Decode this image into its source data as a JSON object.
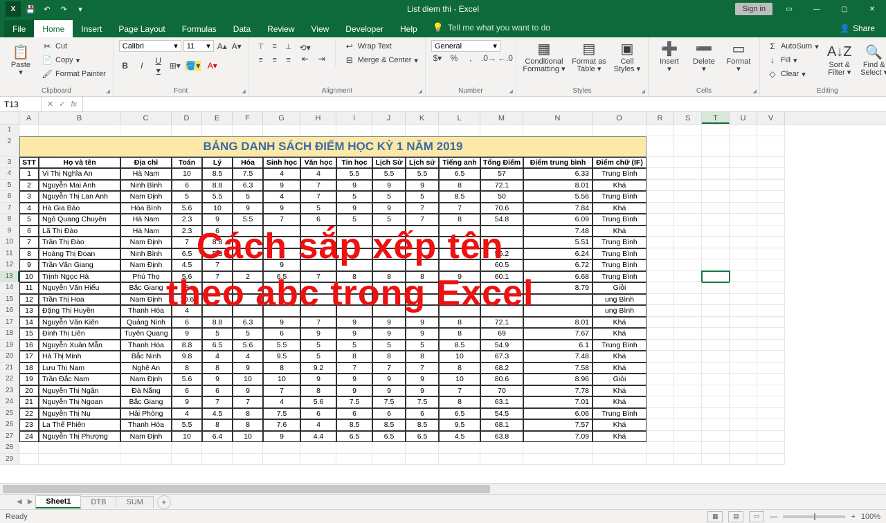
{
  "app": {
    "title": "List diem thi  -  Excel",
    "signin": "Sign in"
  },
  "tabs": {
    "file": "File",
    "home": "Home",
    "insert": "Insert",
    "page_layout": "Page Layout",
    "formulas": "Formulas",
    "data": "Data",
    "review": "Review",
    "view": "View",
    "developer": "Developer",
    "help": "Help",
    "tell_me": "Tell me what you want to do",
    "share": "Share"
  },
  "ribbon": {
    "paste": "Paste",
    "cut": "Cut",
    "copy": "Copy",
    "format_painter": "Format Painter",
    "clipboard": "Clipboard",
    "font_name": "Calibri",
    "font_size": "11",
    "font": "Font",
    "wrap": "Wrap Text",
    "merge": "Merge & Center",
    "alignment": "Alignment",
    "num_format": "General",
    "number": "Number",
    "cond": "Conditional Formatting",
    "fat": "Format as Table",
    "cellsty": "Cell Styles",
    "styles": "Styles",
    "insert": "Insert",
    "delete": "Delete",
    "format": "Format",
    "cells": "Cells",
    "autosum": "AutoSum",
    "fill": "Fill",
    "clear": "Clear",
    "sort": "Sort & Filter",
    "find": "Find & Select",
    "editing": "Editing"
  },
  "fx": {
    "namebox": "T13",
    "fx": "fx"
  },
  "cols": {
    "letters": [
      "A",
      "B",
      "C",
      "D",
      "E",
      "F",
      "G",
      "H",
      "I",
      "J",
      "K",
      "L",
      "M",
      "N",
      "O",
      "R",
      "S",
      "T",
      "U",
      "V"
    ],
    "widths": [
      28,
      118,
      74,
      44,
      44,
      44,
      54,
      52,
      52,
      48,
      48,
      60,
      62,
      100,
      78,
      40,
      40,
      40,
      40,
      40
    ]
  },
  "sheet": {
    "title": "BẢNG DANH SÁCH ĐIỂM HỌC KỲ 1  NĂM 2019",
    "headers": [
      "STT",
      "Họ và tên",
      "Địa chỉ",
      "Toán",
      "Lý",
      "Hóa",
      "Sinh học",
      "Văn học",
      "Tin học",
      "Lịch Sử",
      "Lịch sử",
      "Tiếng anh",
      "Tổng Điểm",
      "Điểm trung bình",
      "Điểm chữ (IF)"
    ]
  },
  "rows": [
    {
      "n": 1,
      "name": "Vi Thị Nghĩa An",
      "addr": "Hà Nam",
      "d": [
        10,
        8.5,
        7.5,
        4,
        4,
        5.5,
        5.5,
        5.5,
        6.5
      ],
      "sum": 57,
      "avg": 6.33,
      "grade": "Trung Bình"
    },
    {
      "n": 2,
      "name": "Nguyễn Mai Anh",
      "addr": "Ninh Bình",
      "d": [
        6,
        8.8,
        6.3,
        9,
        7,
        9,
        9,
        9,
        8
      ],
      "sum": 72.1,
      "avg": 8.01,
      "grade": "Khá"
    },
    {
      "n": 3,
      "name": "Nguyễn Thị Lan Anh",
      "addr": "Nam Định",
      "d": [
        5,
        5.5,
        5,
        4,
        7,
        5,
        5,
        5,
        8.5
      ],
      "sum": 50,
      "avg": 5.56,
      "grade": "Trung Bình"
    },
    {
      "n": 4,
      "name": "Hà Gia Bảo",
      "addr": "Hòa Bình",
      "d": [
        5.6,
        10,
        9,
        9,
        5,
        9,
        9,
        7,
        7
      ],
      "sum": 70.6,
      "avg": 7.84,
      "grade": "Khá"
    },
    {
      "n": 5,
      "name": "Ngô Quang Chuyên",
      "addr": "Hà Nam",
      "d": [
        2.3,
        9,
        5.5,
        7,
        6,
        5,
        5,
        7,
        8
      ],
      "sum": 54.8,
      "avg": 6.09,
      "grade": "Trung Bình"
    },
    {
      "n": 6,
      "name": "Lã Thị Đào",
      "addr": "Hà Nam",
      "d": [
        2.3,
        6,
        "",
        "",
        "",
        "",
        "",
        "",
        ""
      ],
      "sum": "",
      "avg": 7.48,
      "grade": "Khá"
    },
    {
      "n": 7,
      "name": "Trần Thị Đào",
      "addr": "Nam Định",
      "d": [
        7,
        8.8,
        "",
        "",
        "",
        "",
        "",
        "",
        ""
      ],
      "sum": "",
      "avg": 5.51,
      "grade": "Trung Bình"
    },
    {
      "n": 8,
      "name": "Hoàng Thị Đoan",
      "addr": "Ninh Bình",
      "d": [
        6.5,
        5.3,
        "",
        "",
        "",
        "",
        "",
        "",
        ""
      ],
      "sum": 56.2,
      "avg": 6.24,
      "grade": "Trung Bình"
    },
    {
      "n": 9,
      "name": "Trần Văn Giang",
      "addr": "Nam Định",
      "d": [
        4.5,
        7,
        "",
        9,
        "",
        "",
        "",
        "",
        ""
      ],
      "sum": 60.5,
      "avg": 6.72,
      "grade": "Trung Bình"
    },
    {
      "n": 10,
      "name": "Trịnh Ngọc Hà",
      "addr": "Phú Thọ",
      "d": [
        5.6,
        7,
        2,
        6.5,
        7,
        8,
        8,
        8,
        9
      ],
      "sum": 60.1,
      "avg": 6.68,
      "grade": "Trung Bình"
    },
    {
      "n": 11,
      "name": "Nguyễn Văn Hiểu",
      "addr": "Bắc Giang",
      "d": [
        8,
        "",
        "",
        "",
        "",
        "",
        "",
        "",
        ""
      ],
      "sum": "",
      "avg": 8.79,
      "grade": "Giỏi"
    },
    {
      "n": 12,
      "name": "Trần Thị Hoa",
      "addr": "Nam Định",
      "d": [
        10.6,
        "",
        "",
        "",
        "",
        "",
        "",
        "",
        ""
      ],
      "sum": "",
      "avg": "",
      "grade": "ung Bình"
    },
    {
      "n": 13,
      "name": "Đặng Thị Huyền",
      "addr": "Thanh Hóa",
      "d": [
        4,
        "",
        "",
        "",
        "",
        "",
        "",
        "",
        ""
      ],
      "sum": "",
      "avg": "",
      "grade": "ung Bình"
    },
    {
      "n": 14,
      "name": "Nguyễn Văn Kiên",
      "addr": "Quảng Ninh",
      "d": [
        6,
        8.8,
        6.3,
        9,
        7,
        9,
        9,
        9,
        8
      ],
      "sum": 72.1,
      "avg": 8.01,
      "grade": "Khá"
    },
    {
      "n": 15,
      "name": "Đinh Thị Liên",
      "addr": "Tuyên Quang",
      "d": [
        9,
        5,
        5,
        6,
        9,
        9,
        9,
        9,
        8
      ],
      "sum": 69,
      "avg": 7.67,
      "grade": "Khá"
    },
    {
      "n": 16,
      "name": "Nguyễn Xuân Mẫn",
      "addr": "Thanh Hóa",
      "d": [
        8.8,
        6.5,
        5.6,
        5.5,
        5,
        5,
        5,
        5,
        8.5
      ],
      "sum": 54.9,
      "avg": 6.1,
      "grade": "Trung Bình"
    },
    {
      "n": 17,
      "name": "Hà Thị Minh",
      "addr": "Bắc Ninh",
      "d": [
        9.8,
        4,
        4,
        9.5,
        5,
        8,
        8,
        8,
        10
      ],
      "sum": 67.3,
      "avg": 7.48,
      "grade": "Khá"
    },
    {
      "n": 18,
      "name": "Lưu Thị Nam",
      "addr": "Nghệ An",
      "d": [
        8,
        8,
        9,
        8,
        9.2,
        7,
        7,
        7,
        8
      ],
      "sum": 68.2,
      "avg": 7.58,
      "grade": "Khá"
    },
    {
      "n": 19,
      "name": "Trần Đắc Nam",
      "addr": "Nam Định",
      "d": [
        5.6,
        9,
        10,
        10,
        9,
        9,
        9,
        9,
        10
      ],
      "sum": 80.6,
      "avg": 8.96,
      "grade": "Giỏi"
    },
    {
      "n": 20,
      "name": "Nguyễn Thị Ngân",
      "addr": "Đà Nẵng",
      "d": [
        6,
        6,
        9,
        7,
        8,
        9,
        9,
        9,
        7
      ],
      "sum": 70,
      "avg": 7.78,
      "grade": "Khá"
    },
    {
      "n": 21,
      "name": "Nguyễn Thị Ngoan",
      "addr": "Bắc Giang",
      "d": [
        9,
        7,
        7,
        4,
        5.6,
        7.5,
        7.5,
        7.5,
        8
      ],
      "sum": 63.1,
      "avg": 7.01,
      "grade": "Khá"
    },
    {
      "n": 22,
      "name": "Nguyễn Thị Nụ",
      "addr": "Hải Phòng",
      "d": [
        4,
        4.5,
        8,
        7.5,
        6,
        6,
        6,
        6,
        6.5
      ],
      "sum": 54.5,
      "avg": 6.06,
      "grade": "Trung Bình"
    },
    {
      "n": 23,
      "name": "La Thế Phiên",
      "addr": "Thanh Hóa",
      "d": [
        5.5,
        8,
        8,
        7.6,
        4,
        8.5,
        8.5,
        8.5,
        9.5
      ],
      "sum": 68.1,
      "avg": 7.57,
      "grade": "Khá"
    },
    {
      "n": 24,
      "name": "Nguyễn Thị Phượng",
      "addr": "Nam Định",
      "d": [
        10,
        6.4,
        10,
        9,
        4.4,
        6.5,
        6.5,
        6.5,
        4.5
      ],
      "sum": 63.8,
      "avg": 7.09,
      "grade": "Khá"
    }
  ],
  "overlay": {
    "line1": "Cách sắp xếp tên",
    "line2": "theo abc trong Excel"
  },
  "sheets": {
    "s1": "Sheet1",
    "s2": "DTB",
    "s3": "SUM"
  },
  "status": {
    "ready": "Ready",
    "zoom": "100%"
  }
}
